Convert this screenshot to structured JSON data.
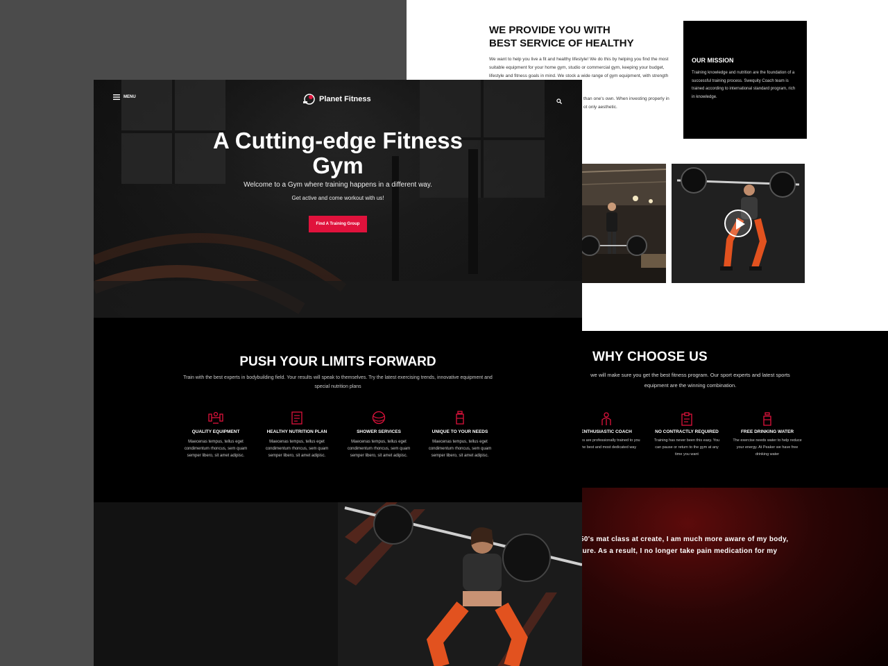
{
  "front": {
    "nav": {
      "menu_label": "MENU",
      "brand": "Planet Fitness"
    },
    "hero": {
      "title": "A Cutting-edge Fitness Gym",
      "subtitle": "Welcome to a Gym where training happens in a different way.",
      "tagline": "Get active and come workout with us!",
      "cta": "Find A Training Group"
    },
    "push": {
      "title": "PUSH YOUR LIMITS FORWARD",
      "subtitle": "Train with the best experts in bodybuilding field. Your results will speak to themselves. Try the latest exercising trends, innovative equipment and special nutrition plans",
      "features": [
        {
          "icon": "barbell-icon",
          "title": "QUALITY EQUIPMENT",
          "text": "Maecenas tempus, tellus eget condimentum rhoncus, sem quam semper libero, sit amet adipisc."
        },
        {
          "icon": "clipboard-icon",
          "title": "HEALTHY NUTRITION PLAN",
          "text": "Maecenas tempus, tellus eget condimentum rhoncus, sem quam semper libero, sit amet adipisc."
        },
        {
          "icon": "ball-icon",
          "title": "SHOWER SERVICES",
          "text": "Maecenas tempus, tellus eget condimentum rhoncus, sem quam semper libero, sit amet adipisc."
        },
        {
          "icon": "bottle-icon",
          "title": "UNIQUE TO YOUR NEEDS",
          "text": "Maecenas tempus, tellus eget condimentum rhoncus, sem quam semper libero, sit amet adipisc."
        }
      ]
    }
  },
  "back": {
    "service": {
      "title_line1": "WE PROVIDE YOU WITH",
      "title_line2": "BEST SERVICE OF HEALTHY",
      "text": "We want to help you live a fit and healthy lifestyle! We do this by helping you find the most suitable equipment for your home gym, studio or commercial gym, keeping your budget, lifestyle and fitness goals in mind. We stock a wide range of gym equipment, with strength more.",
      "text2": "than one's own. When investing properly in ot only aesthetic."
    },
    "mission": {
      "title": "OUR MISSION",
      "text": "Training knowledge and nutrition are the foundation of a successful training process. Swequity Coach team is trained according to international standard program, rich in knowledge."
    },
    "why": {
      "title": "WHY CHOOSE US",
      "subtitle": "we will make sure you get the best fitness program. Our sport experts and latest sports equipment are the winning combination.",
      "features": [
        {
          "icon": "coach-icon",
          "title": "ENTHUSIASTIC COACH",
          "text": "oaches are professionally trained to you in the best and most dedicated way"
        },
        {
          "icon": "clipboard-icon",
          "title": "NO CONTRACTLY REQUIRED",
          "text": "Training has never been this easy. You can pause or return to the gym at any time you want"
        },
        {
          "icon": "bottle-icon",
          "title": "FREE DRINKING WATER",
          "text": "The exercise needs water to help reduce your energy. At Peaker we have free drinking water"
        }
      ]
    },
    "testimonial": {
      "line1": "50's mat class at create, I am much more aware of my body,",
      "line2": "ture. As a result, I no longer take pain medication for my"
    }
  },
  "colors": {
    "accent": "#e0123c",
    "dark": "#000000",
    "testimonial": "#5c0b0b"
  }
}
